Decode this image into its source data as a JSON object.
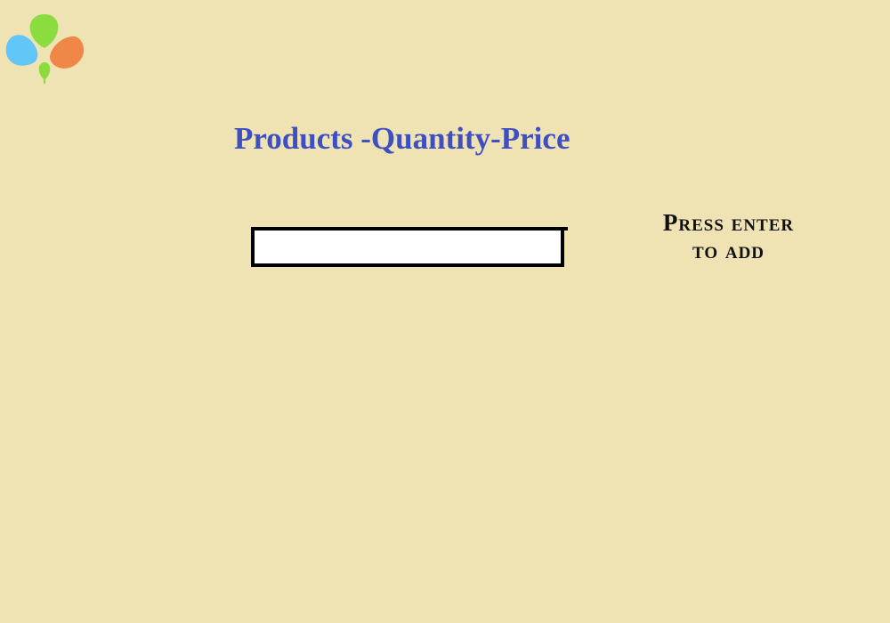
{
  "page": {
    "title": "Products -Quantity-Price"
  },
  "entry": {
    "value": "",
    "placeholder": ""
  },
  "hint": {
    "line1": "Press enter",
    "line2": "to add"
  },
  "icons": {
    "logo": "balloon-cluster-icon"
  },
  "colors": {
    "background": "#efe3b3",
    "title": "#3e4fc4",
    "hint": "#111111",
    "input_border": "#000000",
    "input_fill": "#ffffff",
    "balloon_green": "#8adc3f",
    "balloon_blue": "#63c6f8",
    "balloon_orange": "#ee8747"
  }
}
